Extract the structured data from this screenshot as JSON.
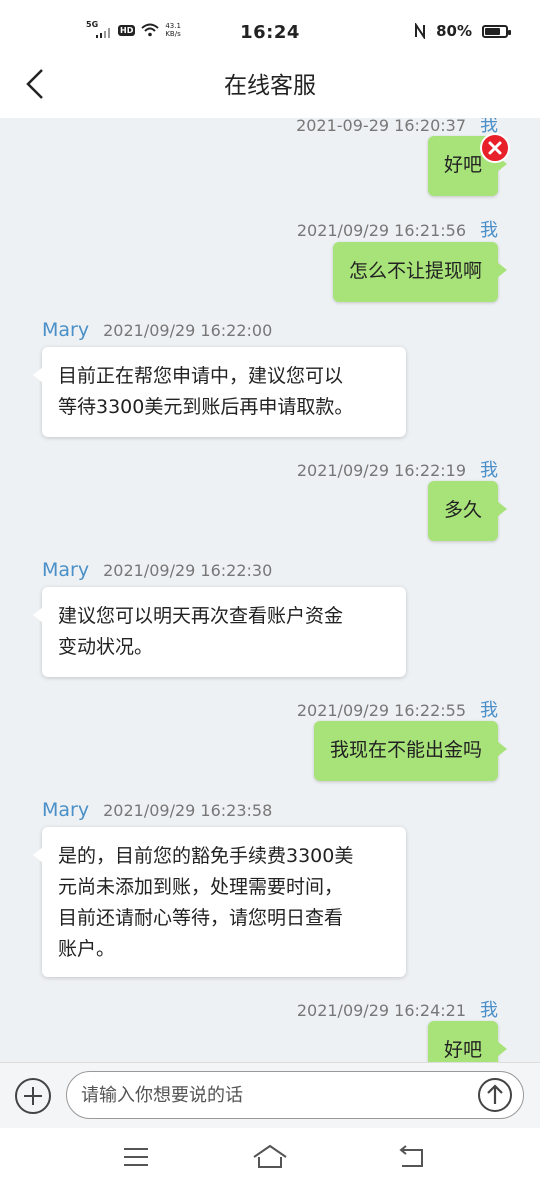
{
  "status_bar": {
    "network": "5G",
    "hd": "HD",
    "speed_value": "43.1",
    "speed_unit": "KB/s",
    "time": "16:24",
    "nfc_icon": "nfc-icon",
    "battery": "80%",
    "battery_level": 0.8
  },
  "header": {
    "title": "在线客服",
    "back_icon": "chevron-left-icon"
  },
  "messages": [
    {
      "side": "right",
      "sender": "我",
      "time": "2021-09-29 16:20:37",
      "text": "好吧",
      "failed": true
    },
    {
      "side": "right",
      "sender": "我",
      "time": "2021/09/29 16:21:56",
      "text": "怎么不让提现啊"
    },
    {
      "side": "left",
      "sender": "Mary",
      "time": "2021/09/29 16:22:00",
      "lines": [
        "目前正在帮您申请中，建议您可以",
        "等待3300美元到账后再申请取款。"
      ]
    },
    {
      "side": "right",
      "sender": "我",
      "time": "2021/09/29 16:22:19",
      "text": "多久"
    },
    {
      "side": "left",
      "sender": "Mary",
      "time": "2021/09/29 16:22:30",
      "lines": [
        "建议您可以明天再次查看账户资金",
        "变动状况。"
      ]
    },
    {
      "side": "right",
      "sender": "我",
      "time": "2021/09/29 16:22:55",
      "text": "我现在不能出金吗"
    },
    {
      "side": "left",
      "sender": "Mary",
      "time": "2021/09/29 16:23:58",
      "lines": [
        "是的，目前您的豁免手续费3300美",
        "元尚未添加到账，处理需要时间，",
        "目前还请耐心等待，请您明日查看",
        "账户。"
      ]
    },
    {
      "side": "right",
      "sender": "我",
      "time": "2021/09/29 16:24:21",
      "text": "好吧"
    }
  ],
  "composer": {
    "placeholder": "请输入你想要说的话",
    "plus_icon": "plus-circle-icon",
    "send_icon": "send-arrow-up-icon"
  },
  "nav_bar": {
    "menu_icon": "menu-icon",
    "home_icon": "home-icon",
    "back_icon": "back-icon"
  },
  "colors": {
    "chat_bg": "#eef1f4",
    "my_bubble": "#a8e37a",
    "agent_bubble": "#ffffff",
    "sender_name": "#4a8fc7",
    "error": "#e8202a"
  }
}
